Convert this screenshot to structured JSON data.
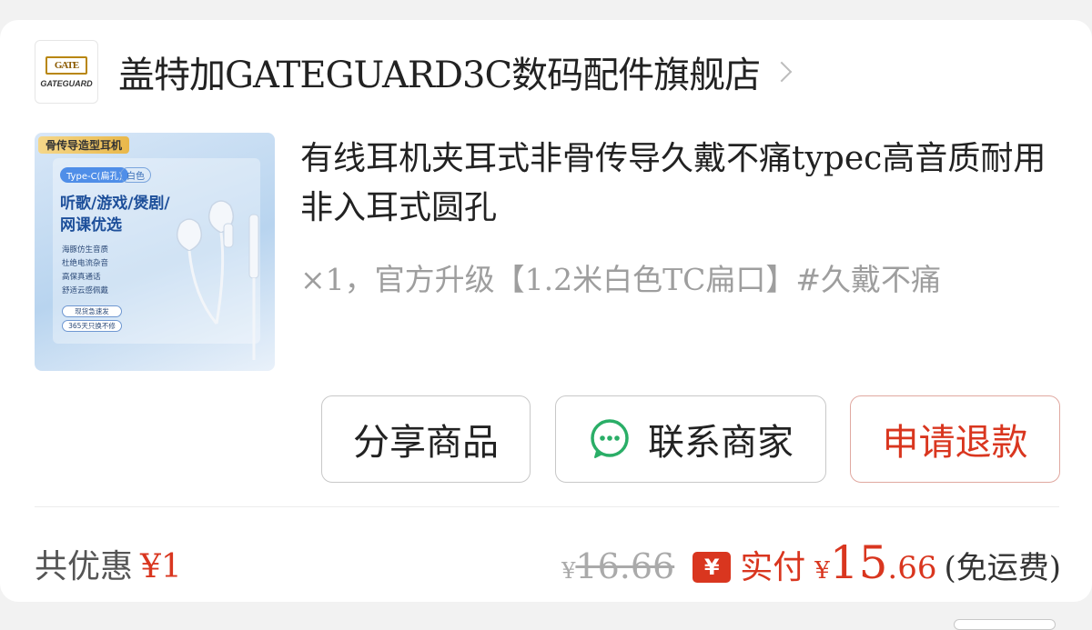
{
  "shop": {
    "logo_mark": "GATE",
    "logo_word": "GATEGUARD",
    "name": "盖特加GATEGUARD3C数码配件旗舰店"
  },
  "product": {
    "image": {
      "tag": "骨传导造型耳机",
      "chip_type": "Type-C(扁孔)",
      "chip_color": "白色",
      "headline": "听歌/游戏/煲剧/网课优选",
      "bullets": [
        "海豚仿生音质",
        "杜绝电流杂音",
        "高保真通话",
        "舒适云感佩戴"
      ],
      "pill_1": "现货急速发",
      "pill_2": "365天只换不修"
    },
    "title": "有线耳机夹耳式非骨传导久戴不痛typec高音质耐用非入耳式圆孔",
    "sku": "×1，官方升级【1.2米白色TC扁口】#久戴不痛"
  },
  "actions": {
    "share_label": "分享商品",
    "contact_label": "联系商家",
    "refund_label": "申请退款"
  },
  "summary": {
    "discount_label": "共优惠",
    "discount_amount": "¥1",
    "original_symbol": "¥",
    "original_price": "16.66",
    "badge": "¥",
    "paid_label": "实付",
    "paid_symbol": "¥",
    "paid_integer": "15",
    "paid_decimal": ".66",
    "shipping_note": "(免运费)"
  },
  "colors": {
    "accent_red": "#d9361f",
    "wechat_green": "#2aae67"
  }
}
